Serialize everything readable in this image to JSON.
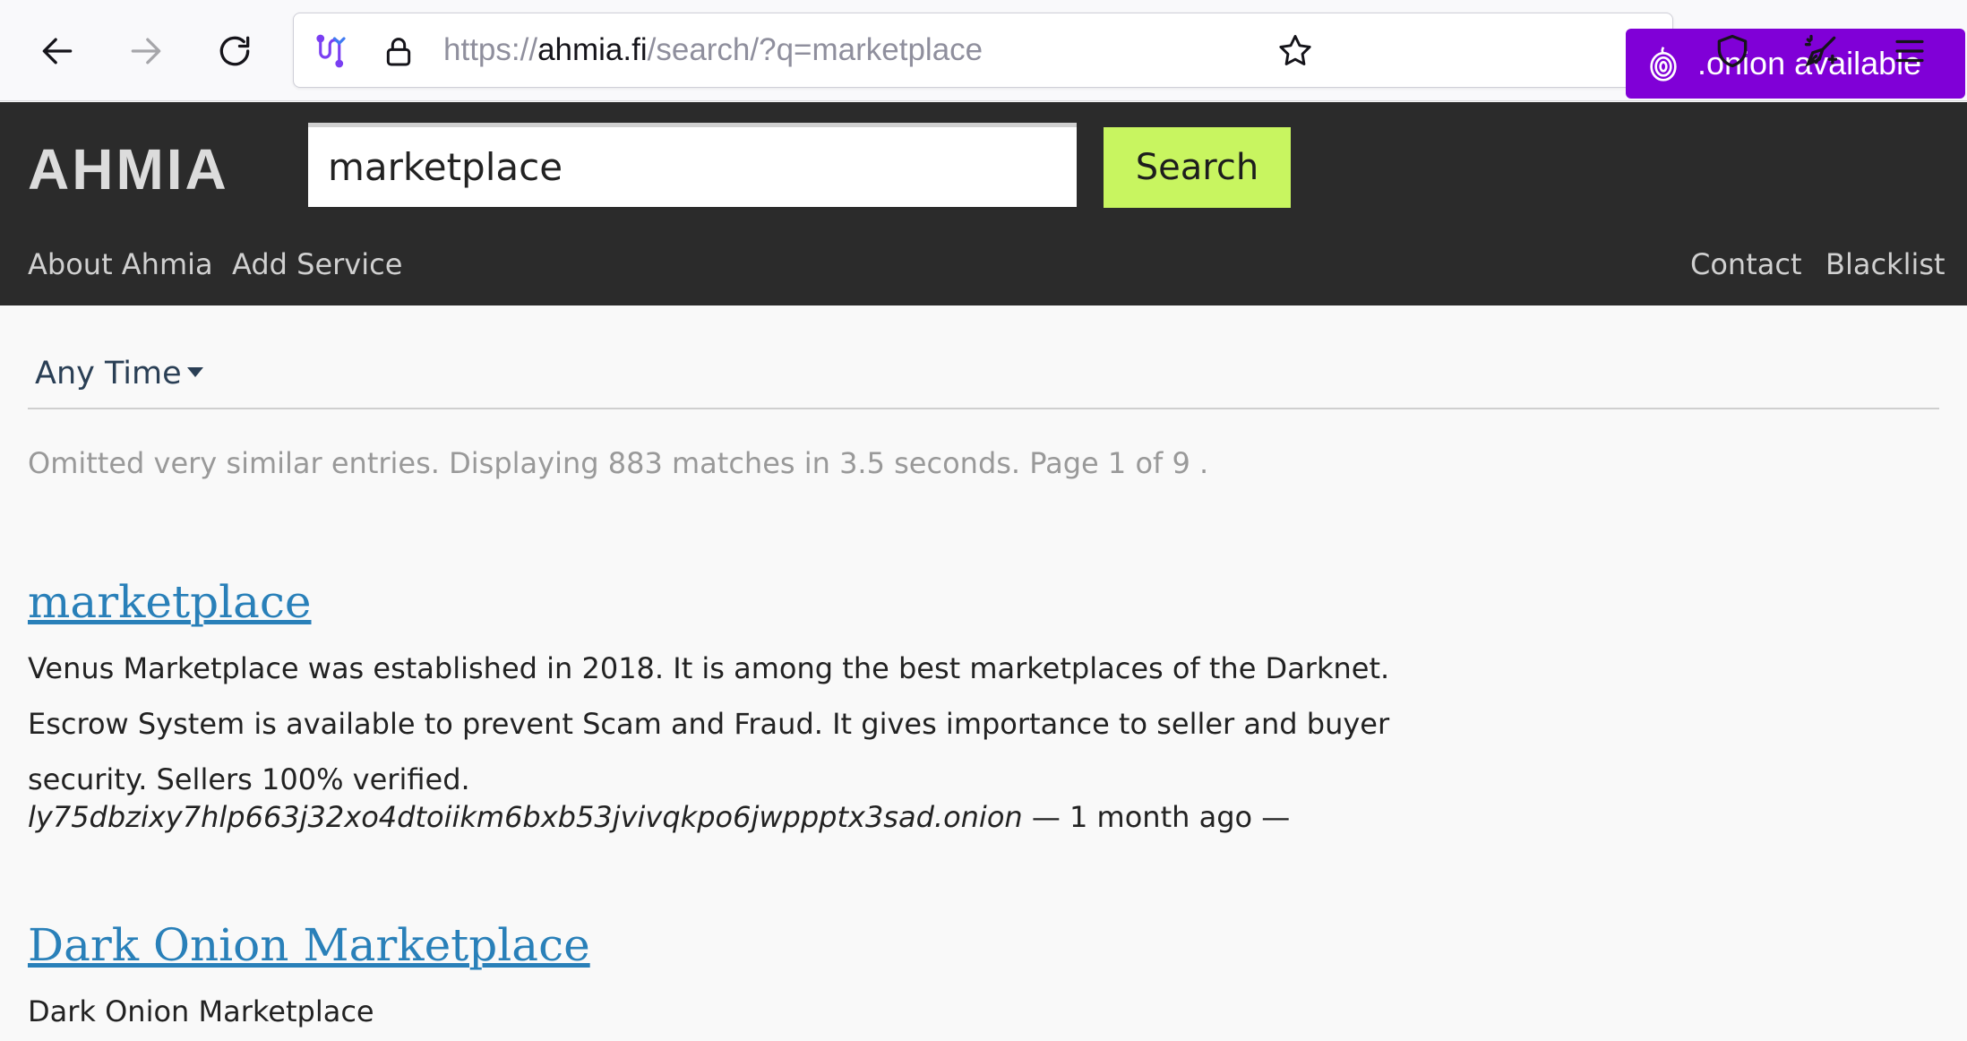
{
  "browser": {
    "url_prefix": "https://",
    "url_host": "ahmia.fi",
    "url_path": "/search/?q=marketplace",
    "onion_badge": ".onion available"
  },
  "site": {
    "logo": "AHMIA",
    "search_value": "marketplace",
    "search_button": "Search",
    "nav_left": [
      "About Ahmia",
      "Add Service"
    ],
    "nav_right": [
      "Contact",
      "Blacklist"
    ]
  },
  "filter": {
    "time_label": "Any Time"
  },
  "stats": "Omitted very similar entries. Displaying 883 matches in 3.5 seconds. Page 1 of 9 .",
  "results": [
    {
      "title": "marketplace",
      "description": "Venus Marketplace was established in 2018. It is among the best marketplaces of the Darknet. Escrow System is available to prevent Scam and Fraud. It gives importance to seller and buyer security. Sellers 100% verified.",
      "onion": "ly75dbzixy7hlp663j32xo4dtoiikm6bxb53jvivqkpo6jwppptx3sad.onion",
      "meta_suffix": " — 1 month ago —"
    },
    {
      "title": "Dark Onion Marketplace",
      "description": "Dark Onion Marketplace"
    }
  ]
}
